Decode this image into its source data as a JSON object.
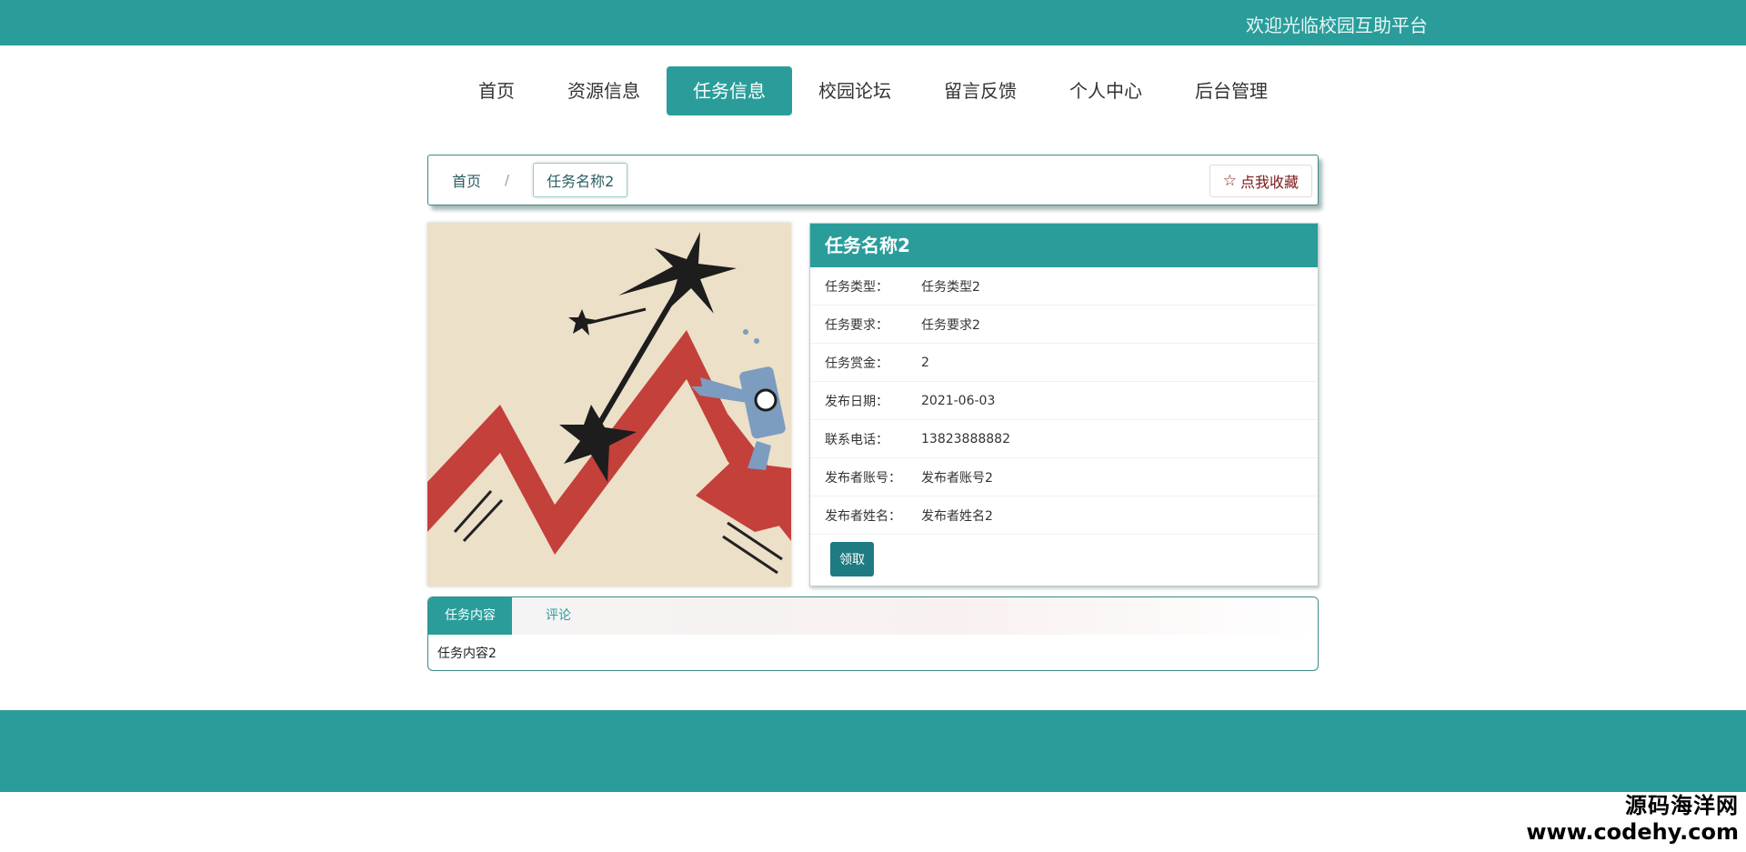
{
  "header": {
    "welcome": "欢迎光临校园互助平台"
  },
  "nav": {
    "items": [
      "首页",
      "资源信息",
      "任务信息",
      "校园论坛",
      "留言反馈",
      "个人中心",
      "后台管理"
    ],
    "active_index": 2
  },
  "breadcrumb": {
    "home": "首页",
    "separator": "/",
    "current": "任务名称2",
    "favorite": "点我收藏"
  },
  "task": {
    "title": "任务名称2",
    "fields": [
      {
        "label": "任务类型：",
        "value": "任务类型2"
      },
      {
        "label": "任务要求：",
        "value": "任务要求2"
      },
      {
        "label": "任务赏金：",
        "value": "2"
      },
      {
        "label": "发布日期：",
        "value": "2021-06-03"
      },
      {
        "label": "联系电话：",
        "value": "13823888882"
      },
      {
        "label": "发布者账号：",
        "value": "发布者账号2"
      },
      {
        "label": "发布者姓名：",
        "value": "发布者姓名2"
      }
    ],
    "receive_button": "领取"
  },
  "tabs": {
    "items": [
      "任务内容",
      "评论"
    ],
    "active_index": 0,
    "content": "任务内容2"
  },
  "watermark": {
    "line1": "源码海洋网",
    "line2": "www.codehy.com"
  },
  "colors": {
    "primary": "#2a9d9b",
    "button_dark": "#1e7b82",
    "favorite": "#7a1b1b"
  }
}
